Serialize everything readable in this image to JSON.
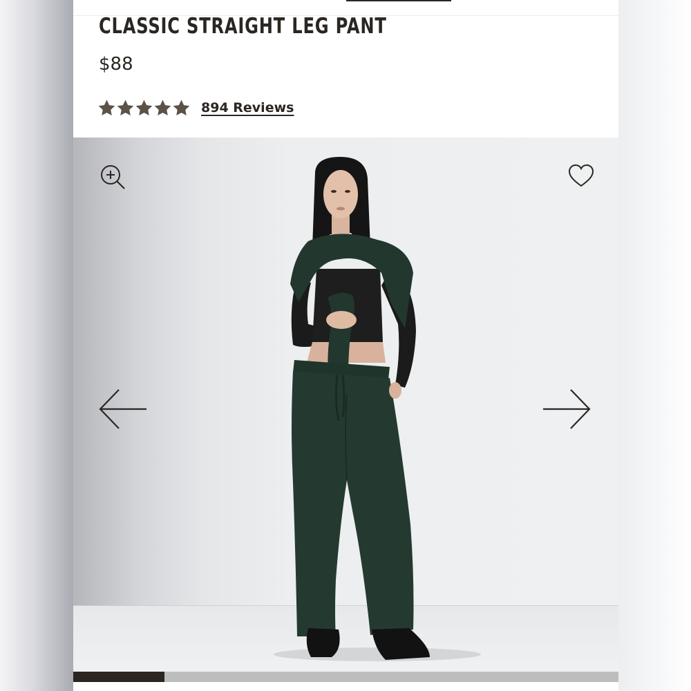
{
  "product": {
    "title": "CLASSIC STRAIGHT LEG PANT",
    "price": "$88",
    "rating": 5,
    "rating_max": 5,
    "reviews_label": "894 Reviews"
  },
  "gallery": {
    "zoom_icon": "zoom-in-icon",
    "favorite_icon": "heart-icon",
    "prev_icon": "arrow-left-icon",
    "next_icon": "arrow-right-icon",
    "progress_fraction": 0.167
  },
  "colors": {
    "text": "#2b2622",
    "star": "#5c5248",
    "pant": "#243a30",
    "progress_fill": "#2b2622",
    "progress_track": "#bdbdbd"
  }
}
